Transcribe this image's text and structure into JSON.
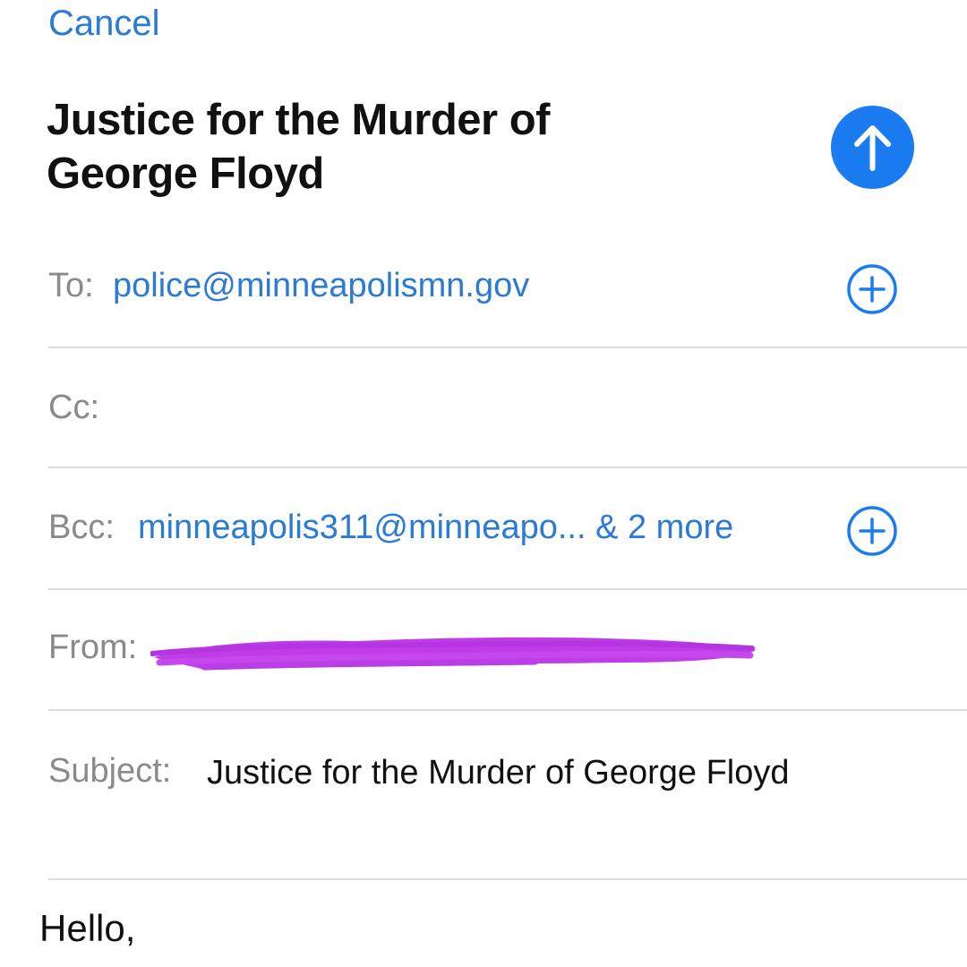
{
  "header": {
    "cancel_label": "Cancel",
    "title": "Justice for the Murder of George Floyd"
  },
  "fields": {
    "to": {
      "label": "To:",
      "value": "police@minneapolismn.gov"
    },
    "cc": {
      "label": "Cc:",
      "value": ""
    },
    "bcc": {
      "label": "Bcc:",
      "value": "minneapolis311@minneapo... & 2 more"
    },
    "from": {
      "label": "From:"
    },
    "subject": {
      "label": "Subject:",
      "value": "Justice for the Murder of George Floyd"
    }
  },
  "body": {
    "text": "Hello,"
  },
  "icons": {
    "send": "arrow-up-icon",
    "add": "plus-circle-icon"
  },
  "colors": {
    "accent": "#1a7cf0",
    "link": "#2a7ad6",
    "label": "#8a8a8e",
    "divider": "#dcdcdc",
    "redaction": "#c03ce8"
  }
}
